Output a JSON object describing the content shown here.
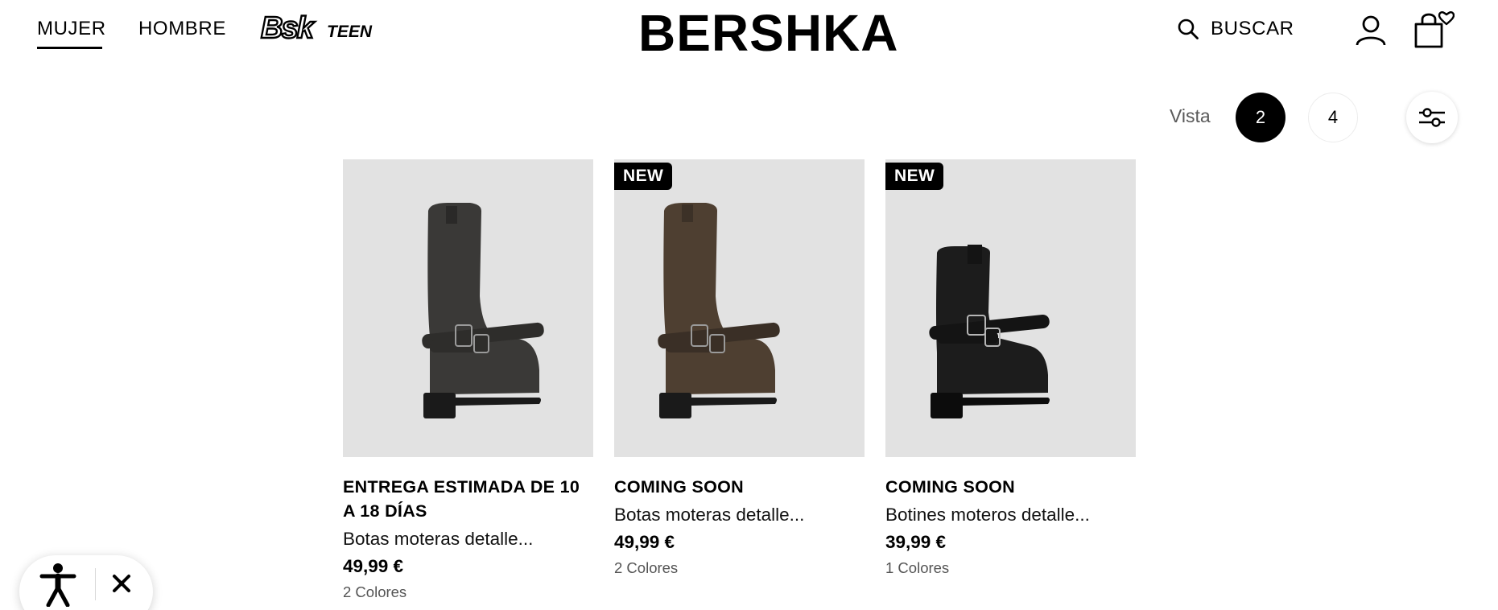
{
  "header": {
    "nav": [
      {
        "label": "MUJER",
        "active": true
      },
      {
        "label": "HOMBRE",
        "active": false
      }
    ],
    "teen_logo": "Bsk TEEN",
    "brand": "BERSHKA",
    "search_label": "BUSCAR",
    "icons": [
      "search-icon",
      "account-icon",
      "shopping-bag-heart-icon"
    ]
  },
  "view_controls": {
    "label": "Vista",
    "options": [
      "2",
      "4"
    ],
    "selected": "2",
    "filter_icon": "filter-sliders-icon"
  },
  "products": [
    {
      "badge": "",
      "status": "ENTREGA ESTIMADA DE 10 A 18 DÍAS",
      "name": "Botas moteras detalle...",
      "price": "49,99 €",
      "colors": "2 Colores",
      "boot_color": "#3a3937"
    },
    {
      "badge": "NEW",
      "status": "COMING SOON",
      "name": "Botas moteras detalle...",
      "price": "49,99 €",
      "colors": "2 Colores",
      "boot_color": "#4e3f31"
    },
    {
      "badge": "NEW",
      "status": "COMING SOON",
      "name": "Botines moteros detalle...",
      "price": "39,99 €",
      "colors": "1 Colores",
      "boot_color": "#1c1c1c"
    }
  ],
  "accessibility_widget": {
    "icons": [
      "accessibility-person-icon",
      "close-icon"
    ]
  },
  "colors": {
    "text": "#000000",
    "muted": "#555555",
    "image_bg": "#e2e2e2",
    "badge_bg": "#000000"
  }
}
